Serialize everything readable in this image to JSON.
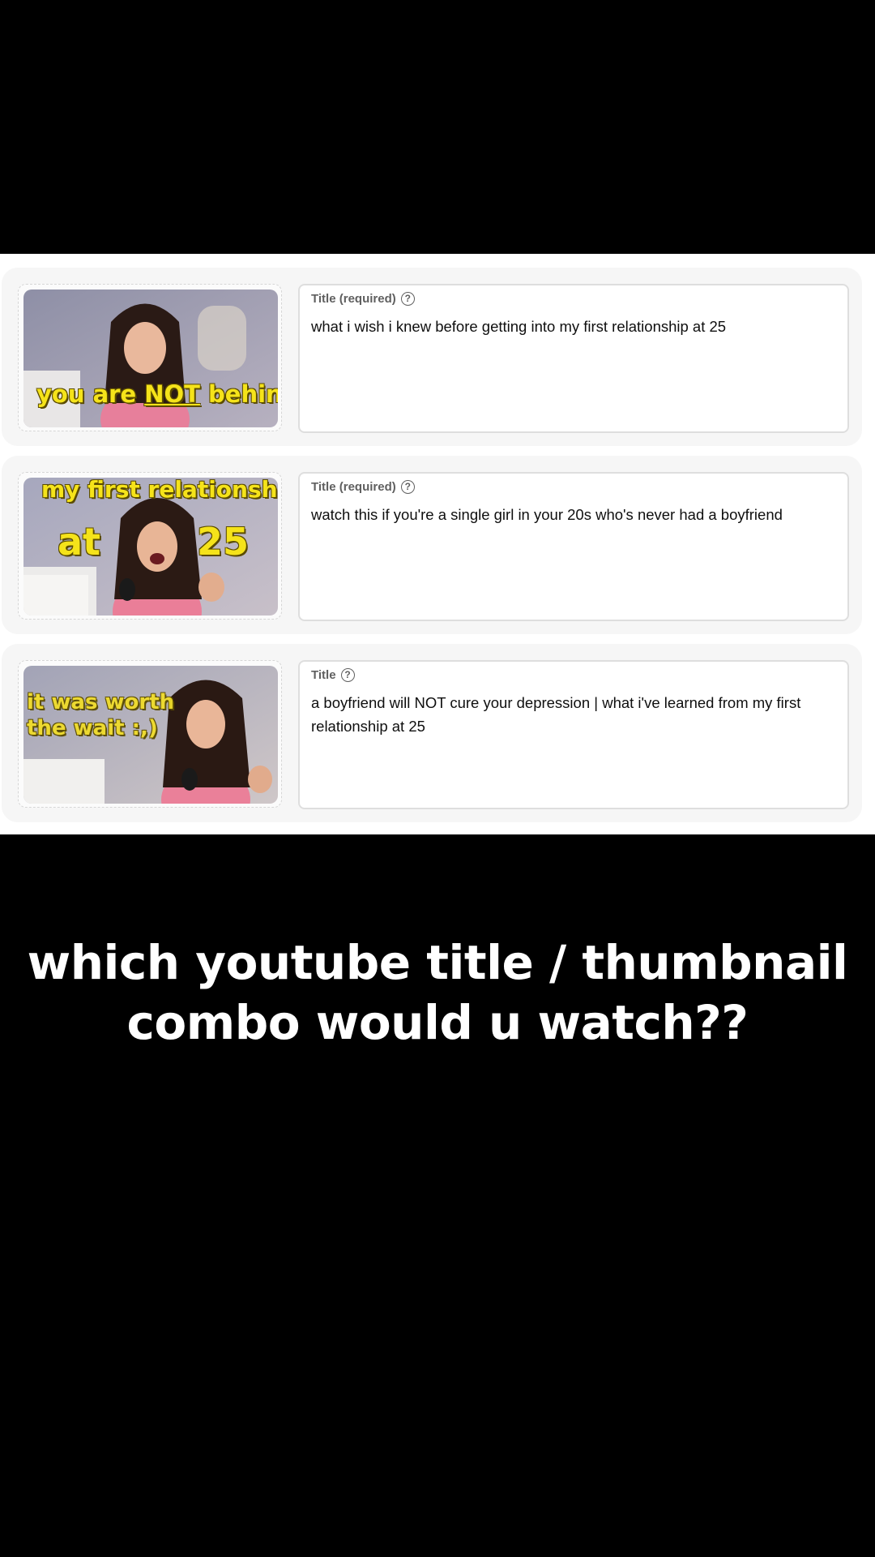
{
  "items": [
    {
      "label": "Title (required)",
      "help": "?",
      "title": "what i wish i knew before getting into my first relationship at 25",
      "thumb_text_1": "you are ",
      "thumb_text_2": "NOT",
      "thumb_text_3": " behind"
    },
    {
      "label": "Title (required)",
      "help": "?",
      "title": "watch this if you're a single girl in your 20s who's never had a boyfriend",
      "thumb_text_1": "my first relationship",
      "thumb_text_2": "at",
      "thumb_text_3": "25"
    },
    {
      "label": "Title",
      "help": "?",
      "title": "a boyfriend will NOT cure your depression | what i've learned from my first relationship at 25",
      "thumb_text_1": "it was worth",
      "thumb_text_2": "the wait :,)"
    }
  ],
  "caption": {
    "line1": "which youtube title / thumbnail",
    "line2": "combo would u watch??"
  }
}
